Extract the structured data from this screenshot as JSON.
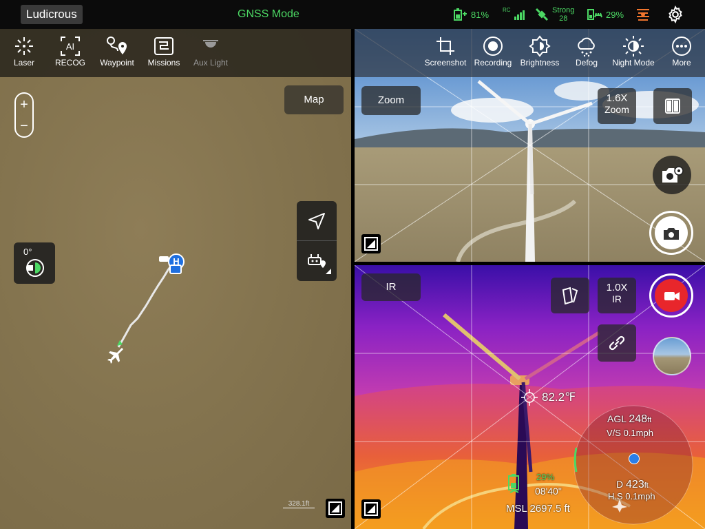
{
  "statusbar": {
    "flight_mode": "Ludicrous",
    "gnss": "GNSS Mode",
    "drone_battery": "81%",
    "rc_label": "RC",
    "signal_label": "Strong",
    "satellites": "28",
    "rc_battery": "29%",
    "accent_color": "#4cd964"
  },
  "map": {
    "tools": [
      {
        "label": "Laser",
        "icon": "laser-icon"
      },
      {
        "label": "RECOG",
        "icon": "ai-recog-icon"
      },
      {
        "label": "Waypoint",
        "icon": "waypoint-icon"
      },
      {
        "label": "Missions",
        "icon": "missions-icon"
      },
      {
        "label": "Aux Light",
        "icon": "aux-light-icon"
      }
    ],
    "zoom_in": "+",
    "zoom_out": "−",
    "map_button": "Map",
    "heading": "0°",
    "home_marker": "H",
    "scale": "328.1ft"
  },
  "camera": {
    "tools": [
      {
        "label": "Screenshot",
        "icon": "crop-icon"
      },
      {
        "label": "Recording",
        "icon": "record-icon"
      },
      {
        "label": "Brightness",
        "icon": "brightness-icon"
      },
      {
        "label": "Defog",
        "icon": "defog-icon"
      },
      {
        "label": "Night Mode",
        "icon": "night-mode-icon"
      },
      {
        "label": "More",
        "icon": "more-icon"
      }
    ],
    "zoom_button": "Zoom",
    "zoom_value": "1.6X",
    "zoom_label": "Zoom"
  },
  "ir": {
    "mode_button": "IR",
    "zoom_value": "1.0X",
    "zoom_label": "IR",
    "spot_temp": "82.2℉",
    "agl_label": "AGL",
    "agl_value": "248",
    "agl_unit": "ft",
    "vs": "V/S 0.1mph",
    "distance_label": "D",
    "distance_value": "423",
    "distance_unit": "ft",
    "hs": "H.S 0.1mph",
    "battery": "29%",
    "flight_time": "08'40\"",
    "msl": "MSL 2697.5 ft",
    "record_color": "#e8262b"
  }
}
